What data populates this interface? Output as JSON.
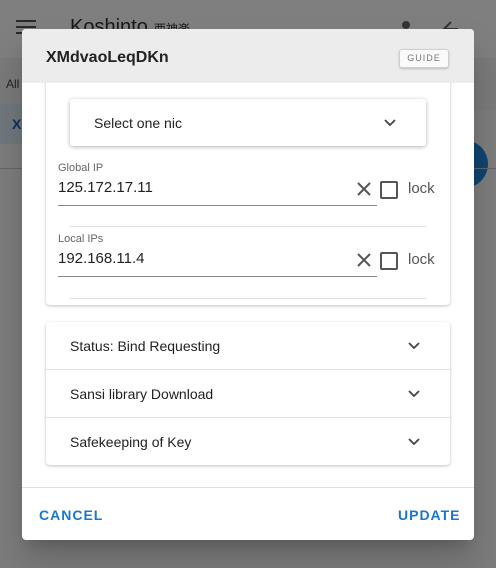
{
  "background": {
    "app_title": "Koshinto",
    "app_subtitle": "西神楽",
    "tab_label": "All",
    "card_label": "X"
  },
  "dialog": {
    "title": "XMdvaoLeqDKn",
    "guide_label": "GUIDE",
    "nic_select": {
      "value": "Select one nic"
    },
    "global_ip": {
      "label": "Global IP",
      "value": "125.172.17.11",
      "lock_label": "lock",
      "locked": false
    },
    "local_ips": {
      "label": "Local IPs",
      "value": "192.168.11.4",
      "lock_label": "lock",
      "locked": false
    },
    "accordion": [
      {
        "label": "Status: Bind Requesting"
      },
      {
        "label": "Sansi library Download"
      },
      {
        "label": "Safekeeping of Key"
      }
    ],
    "cancel_label": "CANCEL",
    "update_label": "UPDATE"
  },
  "colors": {
    "accent": "#1976d2",
    "header": "#ececec",
    "scrim": "rgba(0,0,0,0.5)"
  },
  "icons": [
    "menu-icon",
    "person-icon",
    "back-arrow-icon",
    "chevron-down-icon",
    "clear-icon",
    "checkbox-icon"
  ]
}
